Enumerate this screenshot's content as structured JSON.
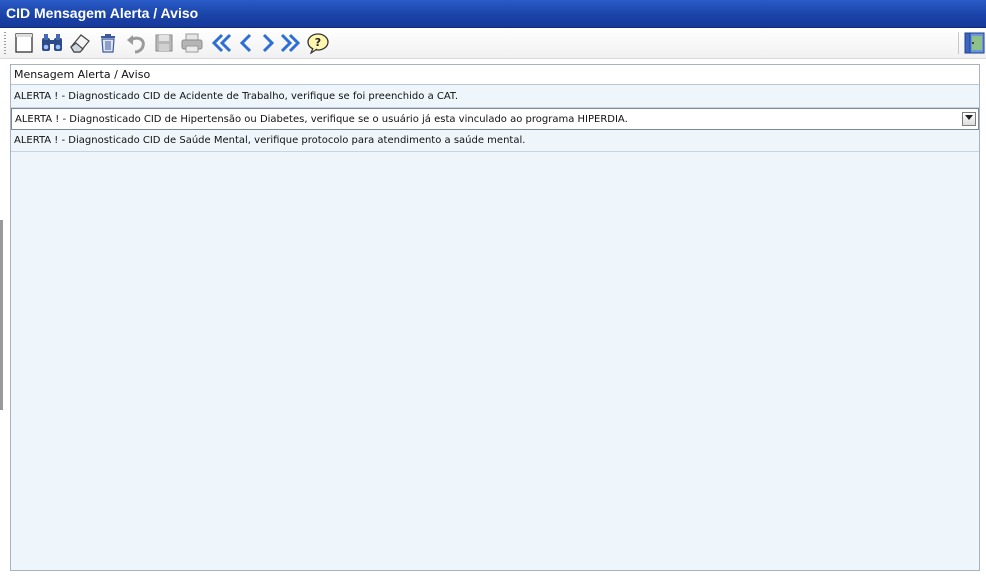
{
  "window": {
    "title": "CID Mensagem Alerta / Aviso"
  },
  "toolbar": {
    "buttons": [
      {
        "name": "new-icon"
      },
      {
        "name": "search-binoculars-icon"
      },
      {
        "name": "eraser-icon"
      },
      {
        "name": "trash-icon"
      },
      {
        "name": "undo-icon"
      },
      {
        "name": "save-icon"
      },
      {
        "name": "print-icon"
      },
      {
        "name": "first-record-icon"
      },
      {
        "name": "previous-record-icon"
      },
      {
        "name": "next-record-icon"
      },
      {
        "name": "last-record-icon"
      },
      {
        "name": "help-icon"
      },
      {
        "name": "exit-door-icon"
      }
    ]
  },
  "grid": {
    "header": "Mensagem Alerta / Aviso",
    "rows": [
      "ALERTA ! - Diagnosticado CID de Acidente de Trabalho, verifique se foi preenchido a CAT.",
      "ALERTA ! - Diagnosticado CID de Hipertensão ou Diabetes, verifique se o usuário já esta vinculado ao programa HIPERDIA.",
      "ALERTA ! - Diagnosticado CID de Saúde Mental, verifique protocolo para atendimento a saúde mental."
    ],
    "selected_row": 1
  },
  "colors": {
    "title_bar": "#1b44a8",
    "grid_bg": "#eef6fc",
    "nav_arrows": "#2d6fd6"
  }
}
